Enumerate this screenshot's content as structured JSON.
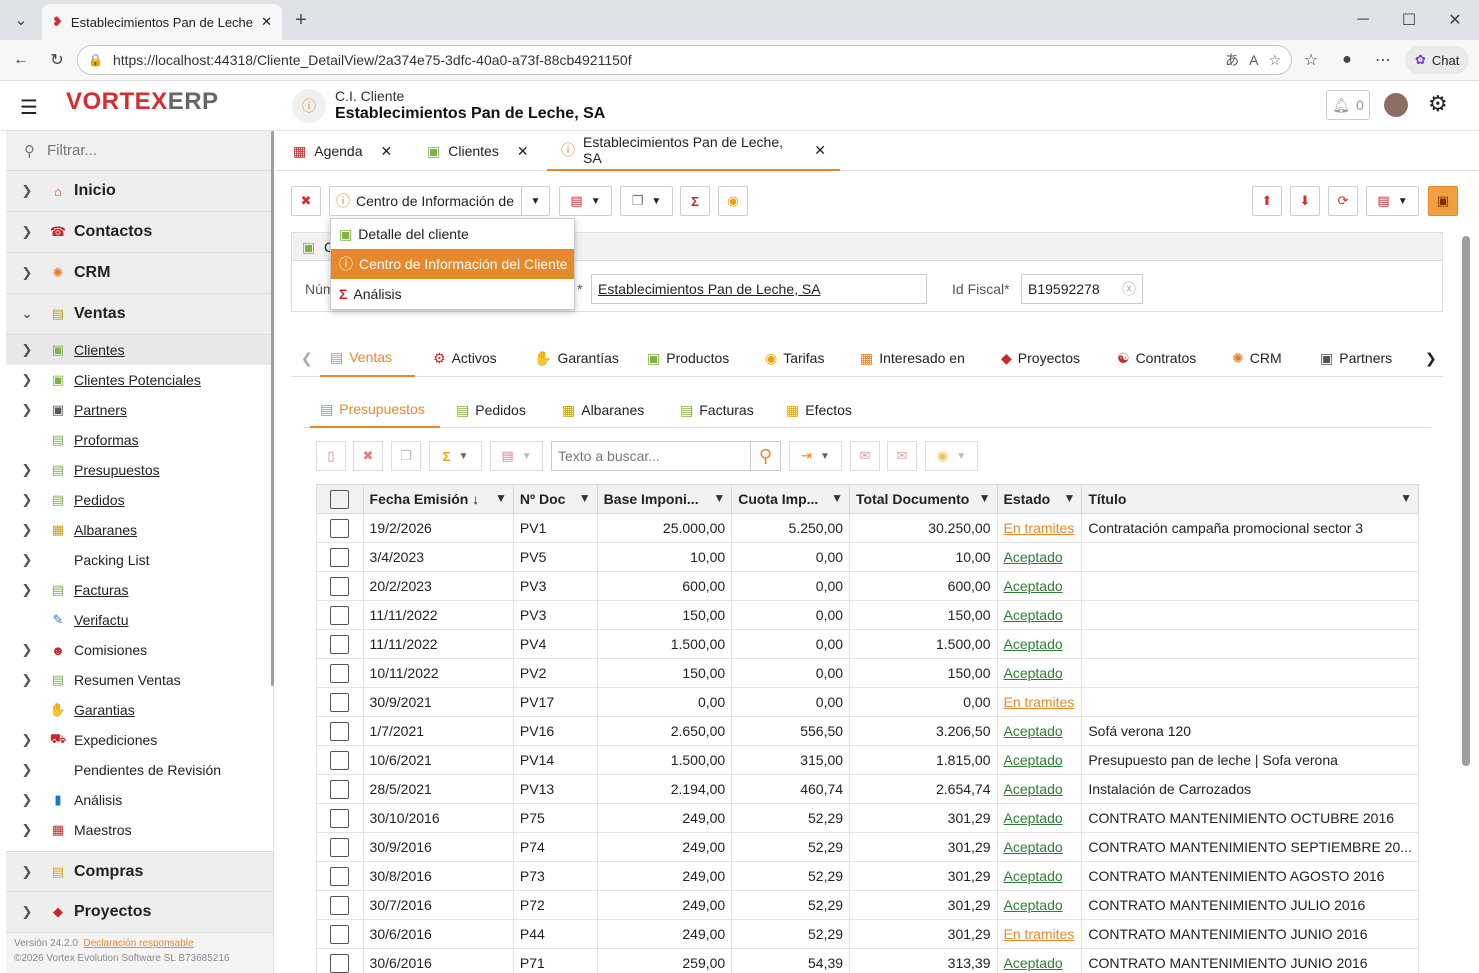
{
  "browser": {
    "tab_title": "Establecimientos Pan de Leche, SA",
    "url": "https://localhost:44318/Cliente_DetailView/2a374e75-3dfc-40a0-a73f-88cb4921150f",
    "chat_label": "Chat"
  },
  "app": {
    "logo_v": "VORTEX",
    "logo_e": "ERP",
    "view_subtitle": "C.I. Cliente",
    "view_title": "Establecimientos Pan de Leche, SA",
    "notifications": "0"
  },
  "sidebar": {
    "filter_placeholder": "Filtrar...",
    "groups": {
      "inicio": "Inicio",
      "contactos": "Contactos",
      "crm": "CRM",
      "ventas": "Ventas",
      "compras": "Compras",
      "proyectos": "Proyectos"
    },
    "ventas_items": [
      "Clientes",
      "Clientes Potenciales",
      "Partners",
      "Proformas",
      "Presupuestos",
      "Pedidos",
      "Albaranes",
      "Packing List",
      "Facturas",
      "Verifactu",
      "Comisiones",
      "Resumen Ventas",
      "Garantias",
      "Expediciones",
      "Pendientes de Revisión",
      "Análisis",
      "Maestros"
    ],
    "version": "Versión 24.2.0",
    "declaracion": "Declaración responsable",
    "copyright": "©2026 Vortex Evolution Software SL B73685216"
  },
  "main_tabs": [
    "Agenda",
    "Clientes",
    "Establecimientos Pan de Leche, SA"
  ],
  "toolbar": {
    "view_selector": "Centro de Información de"
  },
  "dropdown": [
    "Detalle del cliente",
    "Centro de Información del Cliente",
    "Análisis"
  ],
  "form": {
    "num_label": "Núm",
    "name_label": "*",
    "name_value": "Establecimientos Pan de Leche, SA",
    "fiscal_label": "Id Fiscal*",
    "fiscal_value": "B19592278",
    "panel_letter": "C"
  },
  "section_tabs": [
    "Ventas",
    "Activos",
    "Garantías",
    "Productos",
    "Tarifas",
    "Interesado en",
    "Proyectos",
    "Contratos",
    "CRM",
    "Partners"
  ],
  "sub_tabs": [
    "Presupuestos",
    "Pedidos",
    "Albaranes",
    "Facturas",
    "Efectos"
  ],
  "grid": {
    "search_placeholder": "Texto a buscar...",
    "columns": [
      "Fecha Emisión",
      "Nº Doc",
      "Base Imponi...",
      "Cuota Imp...",
      "Total Documento",
      "Estado",
      "Título"
    ],
    "rows": [
      [
        "19/2/2026",
        "PV1",
        "25.000,00",
        "5.250,00",
        "30.250,00",
        "En tramites",
        "Contratación campaña promocional sector 3"
      ],
      [
        "3/4/2023",
        "PV5",
        "10,00",
        "0,00",
        "10,00",
        "Aceptado",
        ""
      ],
      [
        "20/2/2023",
        "PV3",
        "600,00",
        "0,00",
        "600,00",
        "Aceptado",
        ""
      ],
      [
        "11/11/2022",
        "PV3",
        "150,00",
        "0,00",
        "150,00",
        "Aceptado",
        ""
      ],
      [
        "11/11/2022",
        "PV4",
        "1.500,00",
        "0,00",
        "1.500,00",
        "Aceptado",
        ""
      ],
      [
        "10/11/2022",
        "PV2",
        "150,00",
        "0,00",
        "150,00",
        "Aceptado",
        ""
      ],
      [
        "30/9/2021",
        "PV17",
        "0,00",
        "0,00",
        "0,00",
        "En tramites",
        ""
      ],
      [
        "1/7/2021",
        "PV16",
        "2.650,00",
        "556,50",
        "3.206,50",
        "Aceptado",
        "Sofá verona 120"
      ],
      [
        "10/6/2021",
        "PV14",
        "1.500,00",
        "315,00",
        "1.815,00",
        "Aceptado",
        "Presupuesto pan de leche | Sofa verona"
      ],
      [
        "28/5/2021",
        "PV13",
        "2.194,00",
        "460,74",
        "2.654,74",
        "Aceptado",
        "Instalación de Carrozados"
      ],
      [
        "30/10/2016",
        "P75",
        "249,00",
        "52,29",
        "301,29",
        "Aceptado",
        "CONTRATO MANTENIMIENTO OCTUBRE 2016"
      ],
      [
        "30/9/2016",
        "P74",
        "249,00",
        "52,29",
        "301,29",
        "Aceptado",
        "CONTRATO MANTENIMIENTO SEPTIEMBRE 20..."
      ],
      [
        "30/8/2016",
        "P73",
        "249,00",
        "52,29",
        "301,29",
        "Aceptado",
        "CONTRATO MANTENIMIENTO AGOSTO 2016"
      ],
      [
        "30/7/2016",
        "P72",
        "249,00",
        "52,29",
        "301,29",
        "Aceptado",
        "CONTRATO MANTENIMIENTO JULIO 2016"
      ],
      [
        "30/6/2016",
        "P44",
        "249,00",
        "52,29",
        "301,29",
        "En tramites",
        "CONTRATO MANTENIMIENTO JUNIO 2016"
      ],
      [
        "30/6/2016",
        "P71",
        "259,00",
        "54,39",
        "313,39",
        "Aceptado",
        "CONTRATO MANTENIMIENTO JUNIO 2016"
      ]
    ]
  }
}
